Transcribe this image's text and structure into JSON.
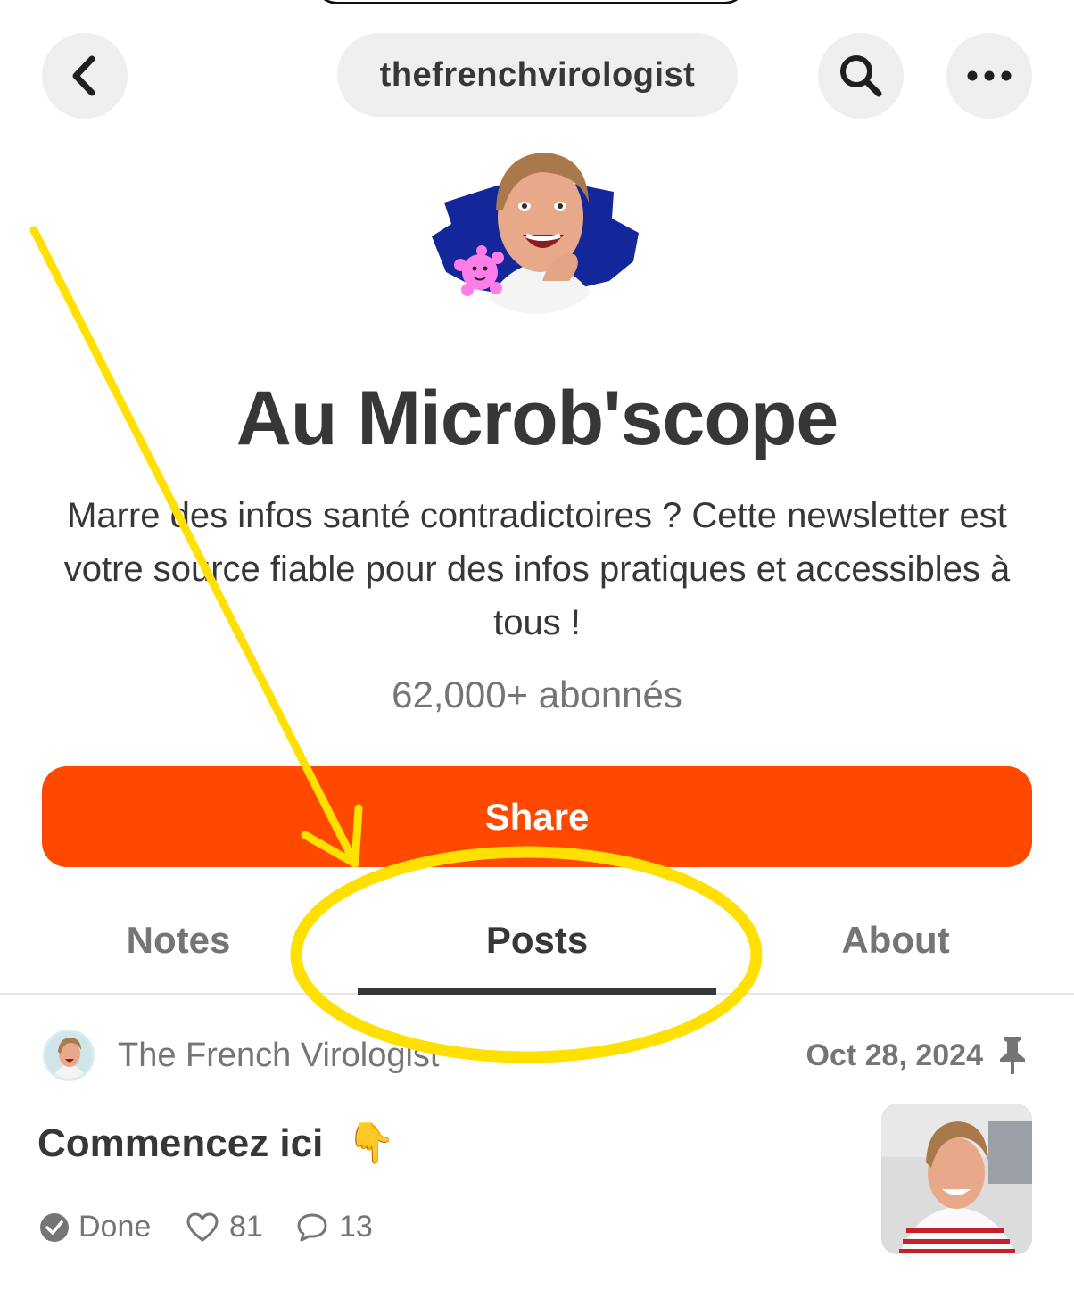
{
  "header": {
    "back_icon": "chevron-left-icon",
    "handle": "thefrenchvirologist",
    "search_icon": "search-icon",
    "more_icon": "ellipsis-icon"
  },
  "profile": {
    "title": "Au Microb'scope",
    "description": "Marre des infos santé contradictoires ? Cette newsletter est votre source fiable pour des infos pratiques et accessibles à tous !",
    "subscribers": "62,000+ abonnés",
    "share_label": "Share"
  },
  "tabs": [
    {
      "label": "Notes",
      "active": false
    },
    {
      "label": "Posts",
      "active": true
    },
    {
      "label": "About",
      "active": false
    }
  ],
  "post": {
    "author": "The French Virologist",
    "date": "Oct 28, 2024",
    "pin_icon": "pin-icon",
    "title": "Commencez ici",
    "emoji": "👇",
    "status": "Done",
    "likes": "81",
    "comments": "13"
  },
  "colors": {
    "accent": "#ff4800",
    "text": "#363737",
    "muted": "#757575",
    "annotation": "#ffe000",
    "avatar_bg": "#14279a"
  }
}
